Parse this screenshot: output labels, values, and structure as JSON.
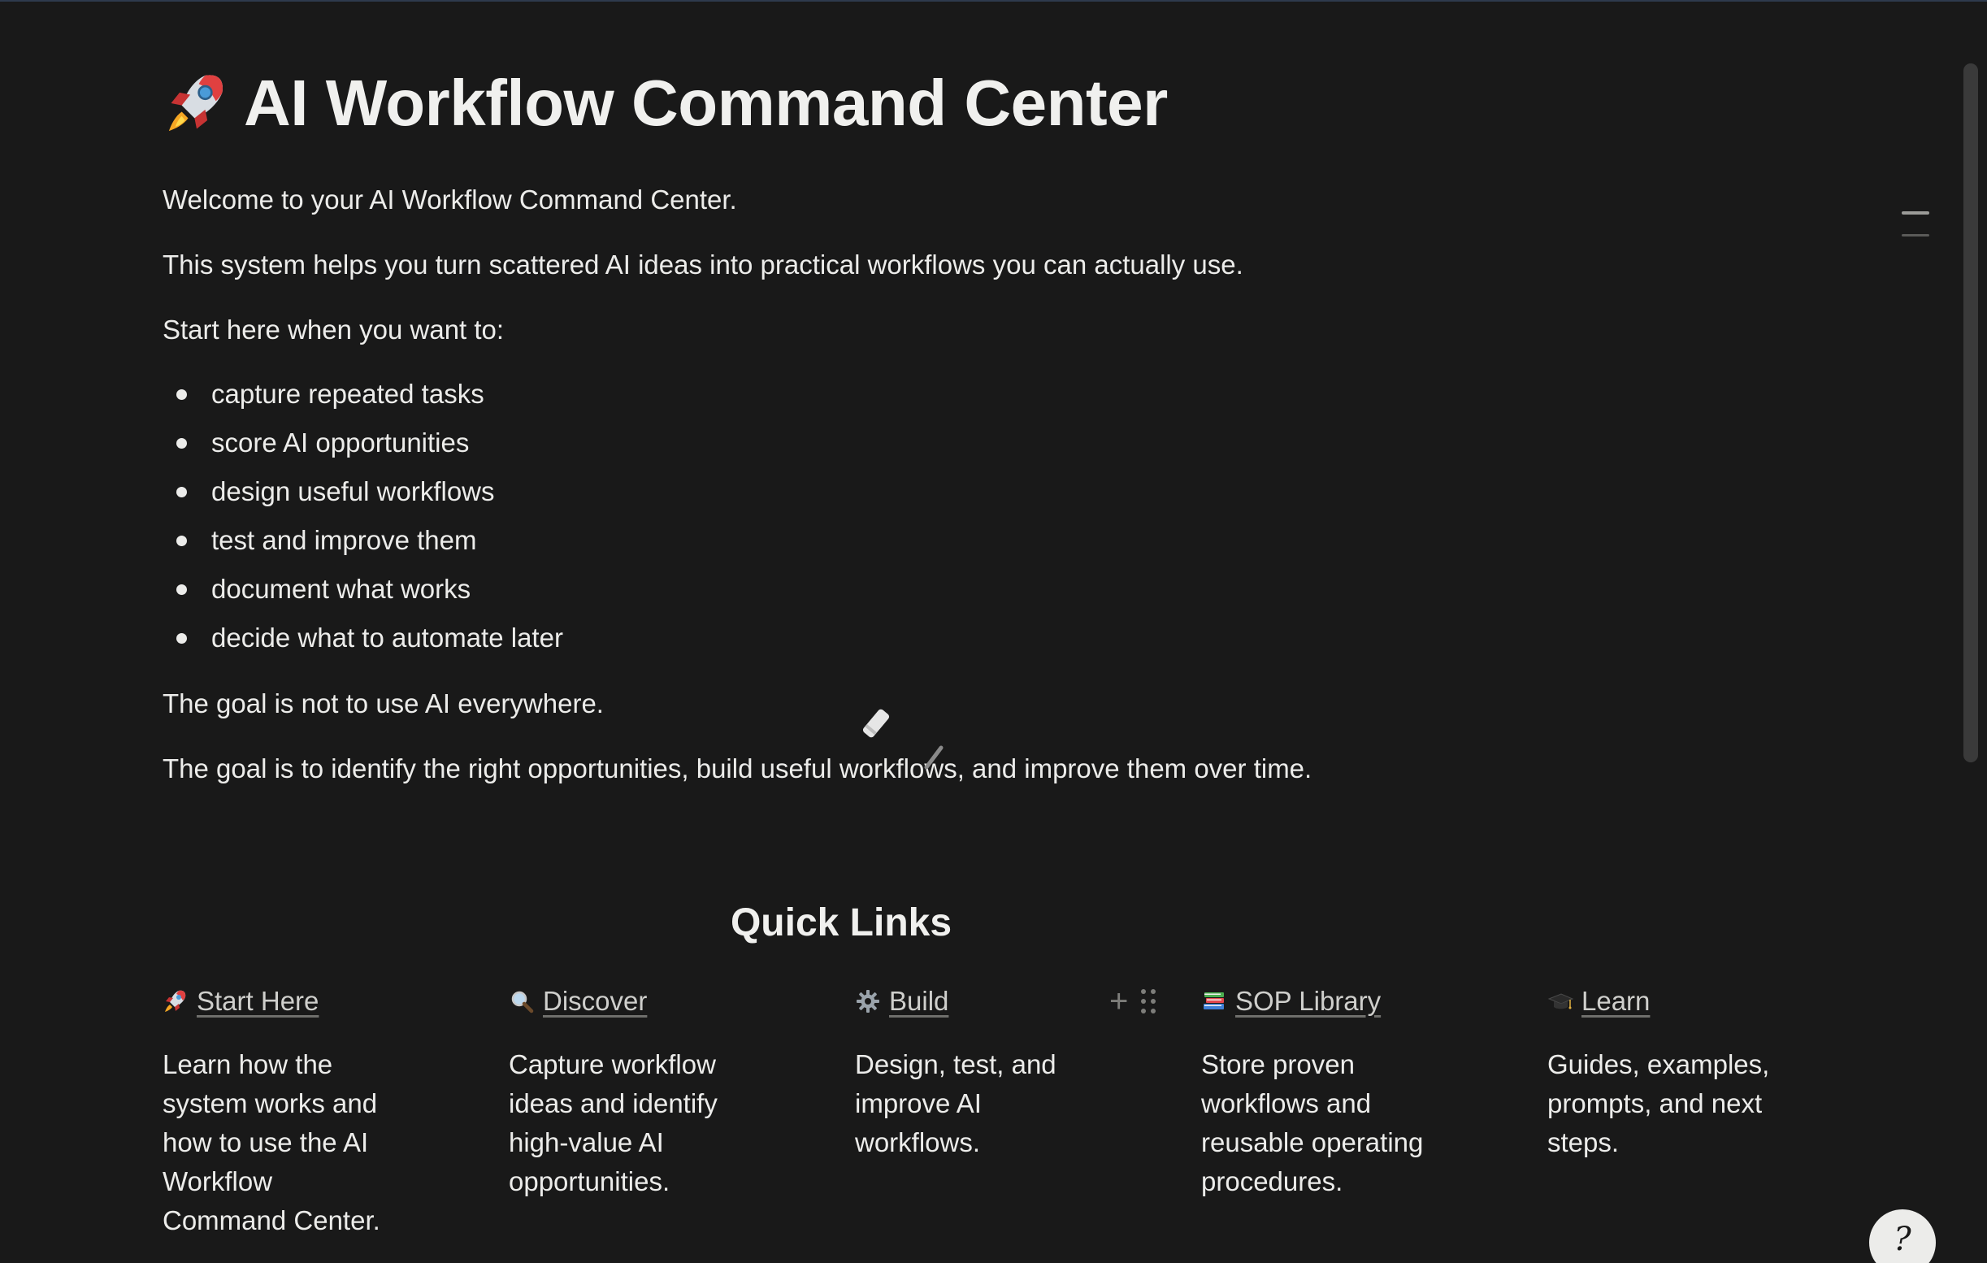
{
  "page": {
    "title_icon": "rocket-icon",
    "title": "AI Workflow Command Center"
  },
  "intro": {
    "line1": "Welcome to your AI Workflow Command Center.",
    "line2": "This system helps you turn scattered AI ideas into practical workflows you can actually use.",
    "line3": "Start here when you want to:"
  },
  "bullets": [
    "capture repeated tasks",
    "score AI opportunities",
    "design useful workflows",
    "test and improve them",
    "document what works",
    "decide what to automate later"
  ],
  "goals": {
    "line1": "The goal is not to use AI everywhere.",
    "line2": "The goal is to identify the right opportunities, build useful workflows, and improve them over time."
  },
  "quick_links": {
    "heading": "Quick Links",
    "items": [
      {
        "icon": "rocket-icon",
        "label": "Start Here",
        "description": "Learn how the system works and how to use the AI Workflow Command Center."
      },
      {
        "icon": "magnifier-icon",
        "label": "Discover",
        "description": "Capture workflow ideas and identify high-value AI opportunities."
      },
      {
        "icon": "gear-icon",
        "label": "Build",
        "description": "Design, test, and improve AI workflows."
      },
      {
        "icon": "books-icon",
        "label": "SOP Library",
        "description": "Store proven workflows and reusable operating procedures."
      },
      {
        "icon": "graduation-cap-icon",
        "label": "Learn",
        "description": "Guides, examples, prompts, and next steps."
      }
    ]
  },
  "controls": {
    "add_block_symbol": "+",
    "help_symbol": "?"
  },
  "colors": {
    "background": "#191919",
    "text": "#ececea",
    "muted": "#7d7d7a"
  }
}
